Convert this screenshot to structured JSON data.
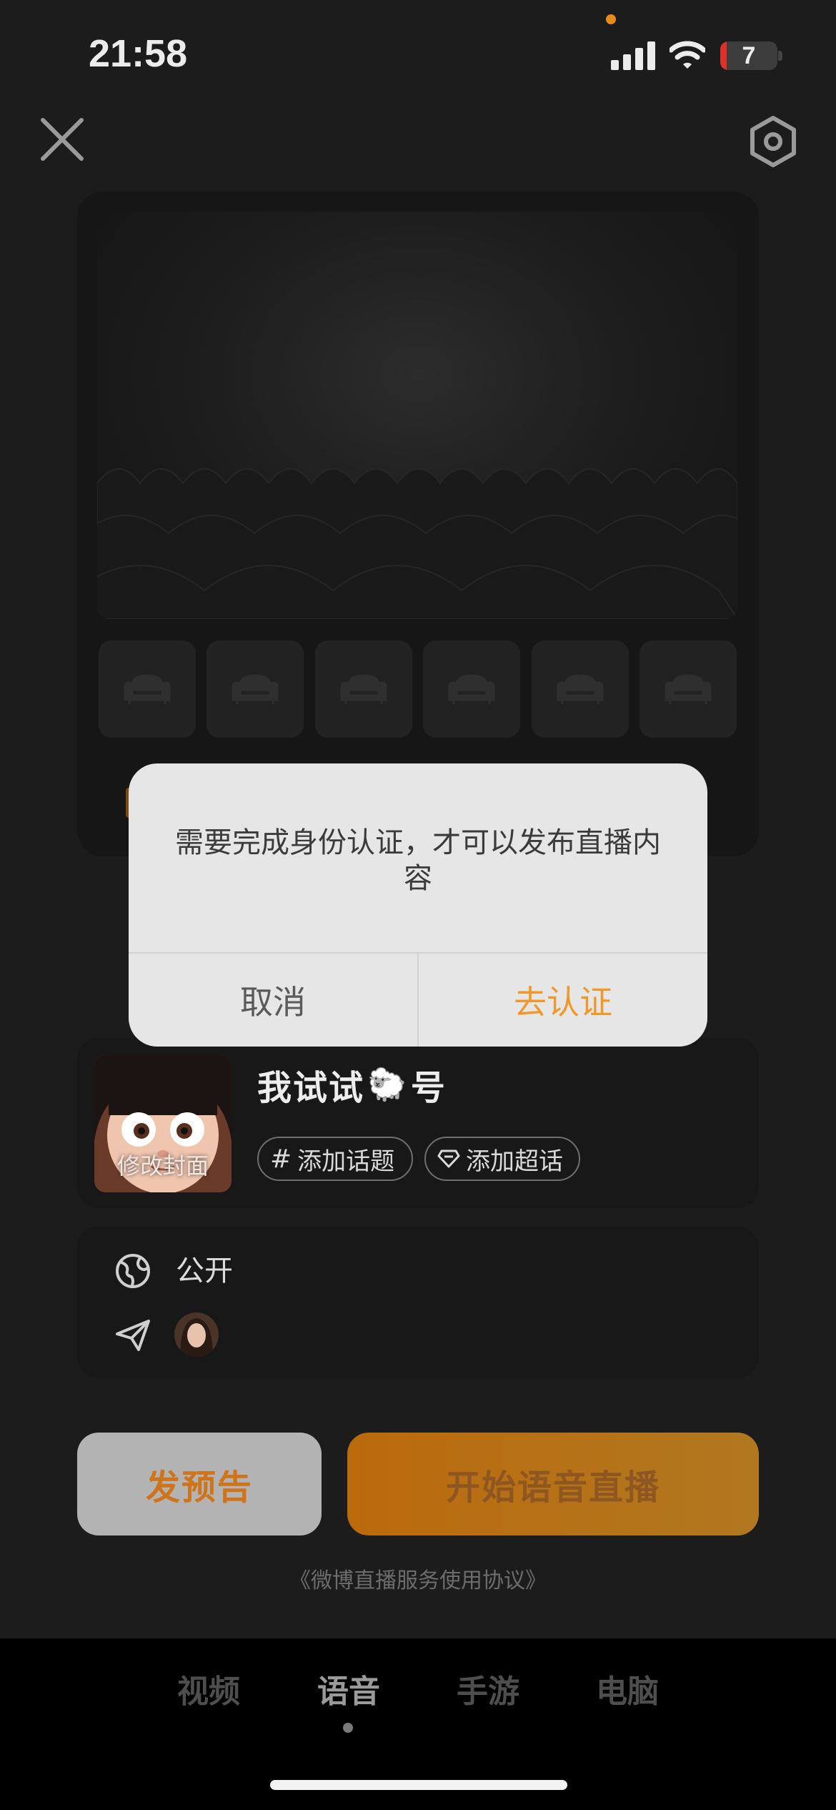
{
  "status_bar": {
    "time": "21:58",
    "battery": "7"
  },
  "top_bar": {
    "close_icon": "close-icon",
    "settings_icon": "settings-icon"
  },
  "live_info": {
    "cover_label": "修改封面",
    "title_prefix": "我试试",
    "title_emoji": "🐑",
    "title_suffix": "号",
    "add_topic": "添加话题",
    "add_super_topic": "添加超话"
  },
  "privacy": {
    "visibility": "公开"
  },
  "actions": {
    "preview_label": "发预告",
    "start_label": "开始语音直播",
    "agreement": "《微博直播服务使用协议》"
  },
  "tabs": [
    {
      "label": "视频",
      "active": false
    },
    {
      "label": "语音",
      "active": true
    },
    {
      "label": "手游",
      "active": false
    },
    {
      "label": "电脑",
      "active": false
    }
  ],
  "dialog": {
    "message": "需要完成身份认证，才可以发布直播内容",
    "cancel": "取消",
    "confirm": "去认证"
  },
  "colors": {
    "accent": "#f0982a",
    "background": "#1c1c1c",
    "dialog_bg": "#e6e6e6"
  }
}
